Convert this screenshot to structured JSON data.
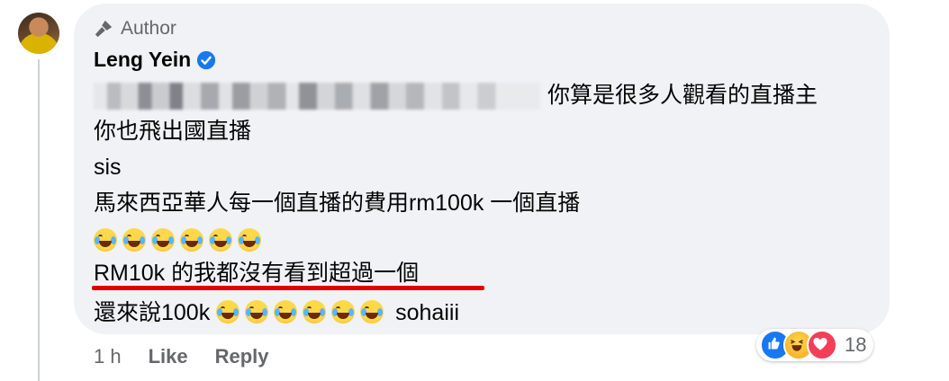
{
  "comment": {
    "author_badge": "Author",
    "author_name": "Leng Yein",
    "lines": [
      "你算是很多人觀看的直播主",
      "你也飛出國直播",
      "sis",
      "馬來西亞華人每一個直播的費用rm100k 一個直播",
      "",
      "RM10k 的我都沒有看到超過一個",
      "還來說100k",
      "sohaiii"
    ]
  },
  "footer": {
    "time": "1 h",
    "like_label": "Like",
    "reply_label": "Reply"
  },
  "reactions": {
    "icons": [
      "like-icon",
      "haha-icon",
      "love-icon"
    ],
    "count": "18"
  }
}
